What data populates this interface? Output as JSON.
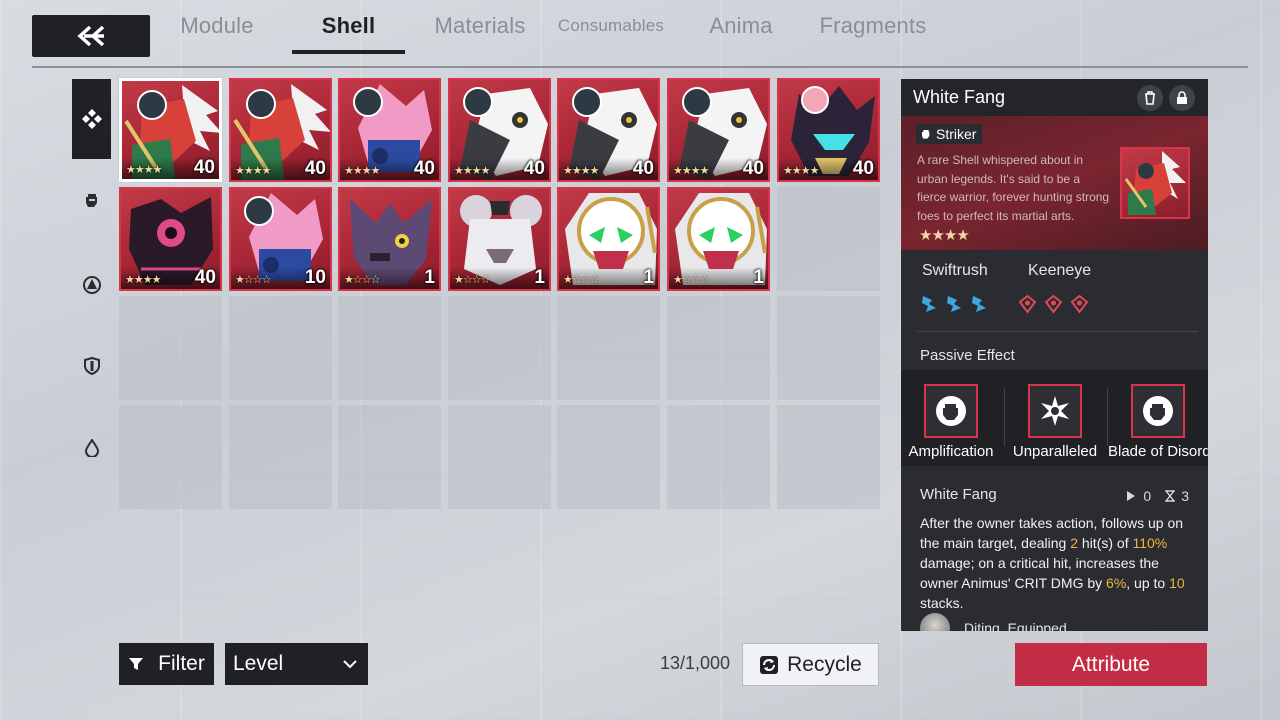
{
  "colors": {
    "accent": "#c22c44",
    "card_red": "#a82636",
    "dark": "#1f2126",
    "highlight": "#f0b43a"
  },
  "tabs": [
    {
      "label": "Module",
      "active": false
    },
    {
      "label": "Shell",
      "active": true
    },
    {
      "label": "Materials",
      "active": false
    },
    {
      "label": "Consumables",
      "active": false
    },
    {
      "label": "Anima",
      "active": false
    },
    {
      "label": "Fragments",
      "active": false
    }
  ],
  "sidebar": [
    "all-icon",
    "striker-icon",
    "target-icon",
    "shield-icon",
    "drop-icon"
  ],
  "cards": [
    {
      "stars": "★★★★",
      "level": "40",
      "selected": true,
      "art": "white-fang"
    },
    {
      "stars": "★★★★",
      "level": "40",
      "selected": false,
      "art": "white-fang"
    },
    {
      "stars": "★★★★",
      "level": "40",
      "selected": false,
      "art": "pink-cat"
    },
    {
      "stars": "★★★★",
      "level": "40",
      "selected": false,
      "art": "white-wolf"
    },
    {
      "stars": "★★★★",
      "level": "40",
      "selected": false,
      "art": "white-wolf"
    },
    {
      "stars": "★★★★",
      "level": "40",
      "selected": false,
      "art": "white-wolf"
    },
    {
      "stars": "★★★★",
      "level": "40",
      "selected": false,
      "art": "dark-cat"
    },
    {
      "stars": "★★★★",
      "level": "40",
      "selected": false,
      "art": "dark-dragon"
    },
    {
      "stars": "★☆☆☆",
      "level": "10",
      "selected": false,
      "art": "pink-cat"
    },
    {
      "stars": "★☆☆☆",
      "level": "1",
      "selected": false,
      "art": "purple-bat"
    },
    {
      "stars": "★☆☆☆",
      "level": "1",
      "selected": false,
      "art": "white-mouse"
    },
    {
      "stars": "★☆☆☆",
      "level": "1",
      "selected": false,
      "art": "green-eye"
    },
    {
      "stars": "★☆☆☆",
      "level": "1",
      "selected": false,
      "art": "green-eye"
    }
  ],
  "footer": {
    "filter_label": "Filter",
    "sort_label": "Level",
    "count": "13/1,000",
    "recycle_label": "Recycle",
    "attribute_label": "Attribute"
  },
  "detail": {
    "name": "White Fang",
    "type": "Striker",
    "description": "A rare Shell whispered about in urban legends. It's said to be a fierce warrior, forever hunting strong foes to perfect its martial arts.",
    "stars": "★★★★",
    "trait1": {
      "name": "Swiftrush",
      "count": 3
    },
    "trait2": {
      "name": "Keeneye",
      "count": 3
    },
    "passive_title": "Passive Effect",
    "passives": [
      "Amplification",
      "Unparalleled",
      "Blade of Disorder"
    ],
    "skill": {
      "name": "White Fang",
      "uses": "0",
      "cooldown": "3",
      "text_1": "After the owner takes action, follows up on the main target, dealing ",
      "hits": "2",
      "text_2": " hit(s) of ",
      "pct": "110%",
      "text_3": " damage; on a critical hit, increases the owner Animus' CRIT DMG by ",
      "crit": "6%",
      "text_4": ", up to ",
      "stacks": "10",
      "text_5": " stacks."
    },
    "owner": {
      "name": "Diting",
      "status": "Equipped"
    }
  }
}
